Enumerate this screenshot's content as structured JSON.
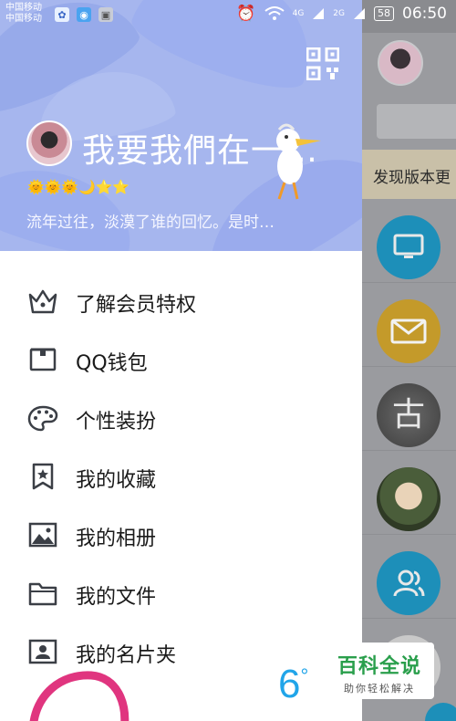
{
  "statusbar": {
    "carrier_1": "中国移动",
    "carrier_2": "中国移动",
    "net_4g": "4G",
    "net_2g": "2G",
    "battery": "58",
    "time": "06:50"
  },
  "profile": {
    "name": "我要我們在一…",
    "level_icons": "🌞🌞🌞🌙⭐⭐",
    "signature": "流年过往，淡漠了谁的回忆。是时…"
  },
  "menu": [
    {
      "label": "了解会员特权",
      "icon": "crown-icon"
    },
    {
      "label": "QQ钱包",
      "icon": "wallet-icon"
    },
    {
      "label": "个性装扮",
      "icon": "palette-icon"
    },
    {
      "label": "我的收藏",
      "icon": "bookmark-star-icon"
    },
    {
      "label": "我的相册",
      "icon": "image-icon"
    },
    {
      "label": "我的文件",
      "icon": "folder-icon"
    },
    {
      "label": "我的名片夹",
      "icon": "contact-card-icon"
    }
  ],
  "weather": {
    "temp": "6",
    "unit": "°"
  },
  "background_app": {
    "notice": "发现版本更"
  },
  "watermark": {
    "title": "百科全说",
    "subtitle": "助你轻松解决"
  },
  "colors": {
    "header_bg": "#a6b6ee",
    "accent_blue": "#21a5e9",
    "watermark_green": "#2a9f4c",
    "annotation_pink": "#e0357f"
  }
}
